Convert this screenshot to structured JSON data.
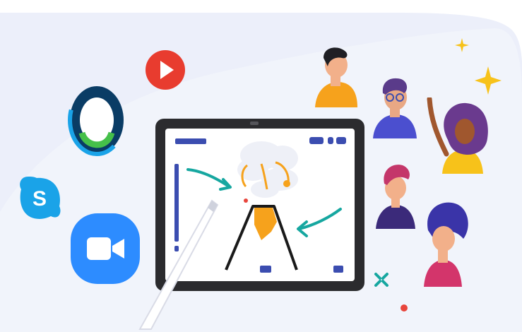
{
  "scene": {
    "colors": {
      "background": "#ffffff",
      "panel": "#eceffa",
      "tablet_frame": "#2b2b2e",
      "tablet_screen": "#ffffff",
      "ui_blue": "#3b4db0",
      "teal_arrow": "#16a7a0",
      "volcano_orange": "#f6a21c",
      "youtube_red": "#e83c2f",
      "skype_blue": "#1aa3e8",
      "zoom_blue": "#2d8cff",
      "webex_green": "#45c04a",
      "webex_navy": "#0a3c65",
      "sparkle_yellow": "#f7c21a",
      "dot_red": "#e8453c"
    },
    "icons": {
      "video_apps": [
        "youtube-icon",
        "webex-icon",
        "skype-icon",
        "zoom-icon"
      ],
      "stylus": "stylus-icon",
      "tablet": "tablet-icon",
      "volcano": "volcano-icon",
      "participants": [
        "person-1",
        "person-2",
        "person-3",
        "person-4",
        "person-5"
      ]
    },
    "skype_letter": "S"
  }
}
